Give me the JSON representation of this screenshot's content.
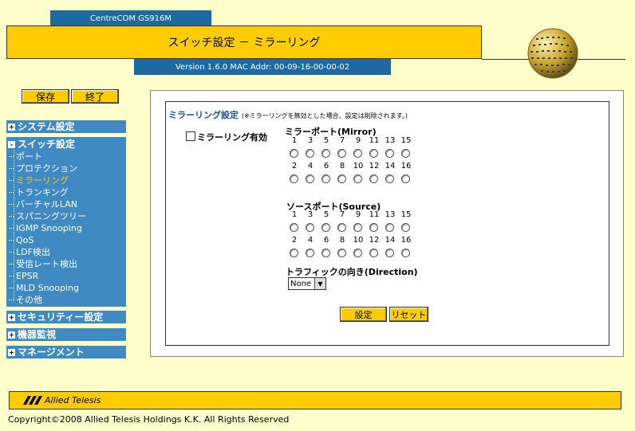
{
  "header": {
    "device_name": "CentreCOM GS916M",
    "page_title": "スイッチ設定 － ミラーリング",
    "version_info": "Version 1.6.0 MAC Addr: 00-09-16-00-00-02"
  },
  "toolbar": {
    "save_label": "保存",
    "end_label": "終了"
  },
  "menu": {
    "system": "システム設定",
    "switch": "スイッチ設定",
    "switch_items": [
      "ポート",
      "プロテクション",
      "ミラーリング",
      "トランキング",
      "バーチャルLAN",
      "スパニングツリー",
      "IGMP Snooping",
      "QoS",
      "LDF検出",
      "受信レート検出",
      "EPSR",
      "MLD Snooping",
      "その他"
    ],
    "security": "セキュリティー設定",
    "monitor": "機器監視",
    "management": "マネージメント",
    "plus_sign": "+",
    "minus_sign": "-"
  },
  "mirror": {
    "section_title": "ミラーリング設定",
    "section_note": "(※ミラーリングを無効とした場合、設定は削除されます。)",
    "enable_label": "ミラーリング有効",
    "mirror_port_label": "ミラーポート(Mirror)",
    "source_port_label": "ソースポート(Source)",
    "odd_ports": [
      "1",
      "3",
      "5",
      "7",
      "9",
      "11",
      "13",
      "15"
    ],
    "even_ports": [
      "2",
      "4",
      "6",
      "8",
      "10",
      "12",
      "14",
      "16"
    ],
    "direction_label": "トラフィックの向き(Direction)",
    "direction_value": "None",
    "set_label": "設定",
    "reset_label": "リセット"
  },
  "footer": {
    "logo_text": "Allied Telesis",
    "copyright": "Copyright©2008 Allied Telesis Holdings K.K. All Rights Reserved"
  }
}
